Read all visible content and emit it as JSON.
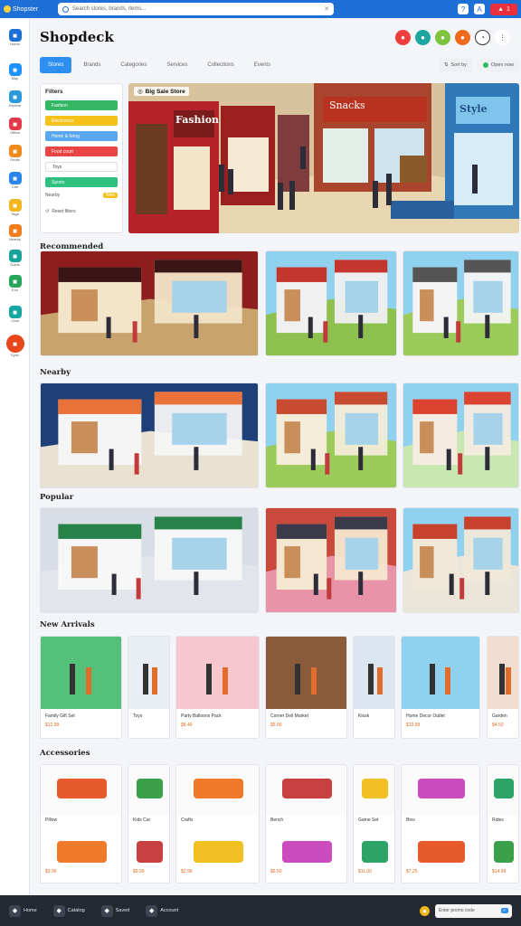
{
  "topbar": {
    "app_name": "Shopster",
    "search_placeholder": "Search stores, brands, items...",
    "search_icon": "search-icon",
    "clear_icon": "close-icon"
  },
  "topbar_right": {
    "help": "?",
    "user": "A",
    "notifications": "1"
  },
  "rail": [
    {
      "icon": "store-icon",
      "label": "Home",
      "color": "#1e6fd6"
    },
    {
      "icon": "map-icon",
      "label": "Map",
      "color": "#1e90ff"
    },
    {
      "icon": "globe-icon",
      "label": "Explore",
      "color": "#2a9ad8"
    },
    {
      "icon": "gift-icon",
      "label": "Offers",
      "color": "#e23a4a"
    },
    {
      "icon": "coin-icon",
      "label": "Deals",
      "color": "#f08a1b"
    },
    {
      "icon": "cart-icon",
      "label": "Cart",
      "color": "#2a85e8"
    },
    {
      "icon": "tag-icon",
      "label": "Tags",
      "color": "#f3b61f"
    },
    {
      "icon": "pin-icon",
      "label": "Nearby",
      "color": "#f07c1a"
    },
    {
      "icon": "compass-icon",
      "label": "Guide",
      "color": "#1aa39a"
    },
    {
      "icon": "leaf-icon",
      "label": "Eco",
      "color": "#27a55a"
    },
    {
      "icon": "chat-icon",
      "label": "Chat",
      "color": "#15a6a0"
    },
    {
      "icon": "refresh-icon",
      "label": "Sync",
      "color": "#2a78d6"
    }
  ],
  "header": {
    "brand": "Shopdeck"
  },
  "tabs": [
    {
      "label": "Stores",
      "active": true
    },
    {
      "label": "Brands"
    },
    {
      "label": "Categories"
    },
    {
      "label": "Services"
    },
    {
      "label": "Collections"
    },
    {
      "label": "Events"
    }
  ],
  "tools": {
    "sort": "Sort by",
    "filter": "Open now"
  },
  "filter": {
    "title": "Filters",
    "chips": [
      {
        "label": "Fashion",
        "color": "#34b866"
      },
      {
        "label": "Electronics",
        "color": "#f4c21b"
      },
      {
        "label": "Home & living",
        "color": "#58a7f0"
      },
      {
        "label": "Food court",
        "color": "#e94545"
      },
      {
        "label": "Toys",
        "color": "#ffffff"
      },
      {
        "label": "Sports",
        "color": "#2ec07e"
      }
    ],
    "extra_label": "Nearby",
    "extra_badge": "New",
    "footer": "Reset filters"
  },
  "hero": {
    "label": "Big Sale Store",
    "store1": "Fashion",
    "store2": "Snacks",
    "store3": "Style"
  },
  "sections": [
    {
      "title": "Recommended"
    },
    {
      "title": "Nearby"
    },
    {
      "title": "Popular"
    },
    {
      "title": "New Arrivals"
    },
    {
      "title": "Accessories"
    }
  ],
  "arrivals": [
    {
      "caption": "Family Gift Set",
      "price": "$12.99"
    },
    {
      "caption": "Toys",
      "price": ""
    },
    {
      "caption": "Party Balloons Pack",
      "price": "$8.49"
    },
    {
      "caption": "Corner Deli Market",
      "price": "$5.00"
    },
    {
      "caption": "Kiosk",
      "price": ""
    },
    {
      "caption": "Home Decor Outlet",
      "price": "$19.99"
    },
    {
      "caption": "Garden",
      "price": "$4.50"
    }
  ],
  "accessories": [
    {
      "caption": "Pillow",
      "price": "$3.99"
    },
    {
      "caption": "Kids Car",
      "price": "$9.99"
    },
    {
      "caption": "Crafts",
      "price": "$2.99"
    },
    {
      "caption": "Bench",
      "price": "$6.50"
    },
    {
      "caption": "Game Set",
      "price": "$11.00"
    },
    {
      "caption": "Bins",
      "price": "$7.25"
    },
    {
      "caption": "Rides",
      "price": "$14.99"
    }
  ],
  "bottombar": {
    "items": [
      {
        "icon": "home-icon",
        "label": "Home"
      },
      {
        "icon": "grid-icon",
        "label": "Catalog"
      },
      {
        "icon": "heart-icon",
        "label": "Saved"
      },
      {
        "icon": "user-icon",
        "label": "Account"
      }
    ],
    "field": "Enter promo code",
    "field_icon": "check-icon"
  }
}
